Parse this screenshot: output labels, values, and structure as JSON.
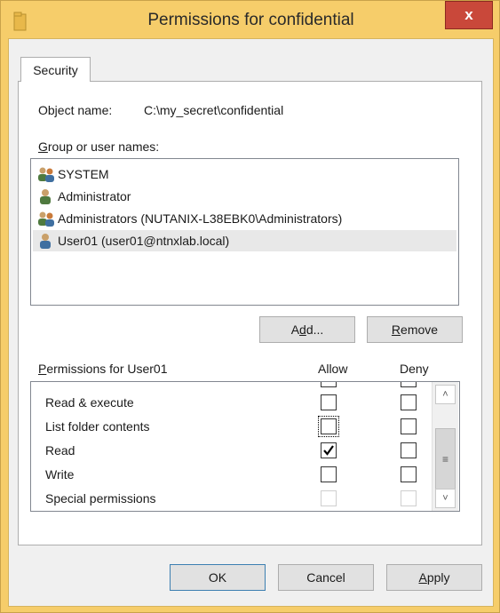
{
  "window": {
    "title": "Permissions for confidential",
    "close_label": "x"
  },
  "tab": {
    "label": "Security"
  },
  "object": {
    "label": "Object name:",
    "value": "C:\\my_secret\\confidential"
  },
  "group_users": {
    "label_prefix": "G",
    "label_rest": "roup or user names:",
    "items": [
      {
        "name": "SYSTEM",
        "icon": "user-group-icon"
      },
      {
        "name": "Administrator",
        "icon": "user-icon"
      },
      {
        "name": "Administrators (NUTANIX-L38EBK0\\Administrators)",
        "icon": "user-group-icon"
      },
      {
        "name": "User01 (user01@ntnxlab.local)",
        "icon": "user-icon",
        "selected": true
      }
    ]
  },
  "buttons": {
    "add_pre": "A",
    "add_u": "d",
    "add_post": "d...",
    "remove_u": "R",
    "remove_post": "emove",
    "ok": "OK",
    "cancel": "Cancel",
    "apply_u": "A",
    "apply_post": "pply"
  },
  "permissions": {
    "label_u": "P",
    "label_rest": "ermissions for User01",
    "allow_header": "Allow",
    "deny_header": "Deny",
    "rows": [
      {
        "name": "Read & execute",
        "allow": false,
        "deny": false,
        "disabled": false
      },
      {
        "name": "List folder contents",
        "allow": false,
        "deny": false,
        "disabled": false,
        "focused": true
      },
      {
        "name": "Read",
        "allow": true,
        "deny": false,
        "disabled": false
      },
      {
        "name": "Write",
        "allow": false,
        "deny": false,
        "disabled": false
      },
      {
        "name": "Special permissions",
        "allow": false,
        "deny": false,
        "disabled": true
      }
    ]
  },
  "colors": {
    "title_bar": "#f6cd6a",
    "close_button": "#c9483a",
    "dialog_bg": "#f0f0f0",
    "selection": "#e8e8e8"
  }
}
